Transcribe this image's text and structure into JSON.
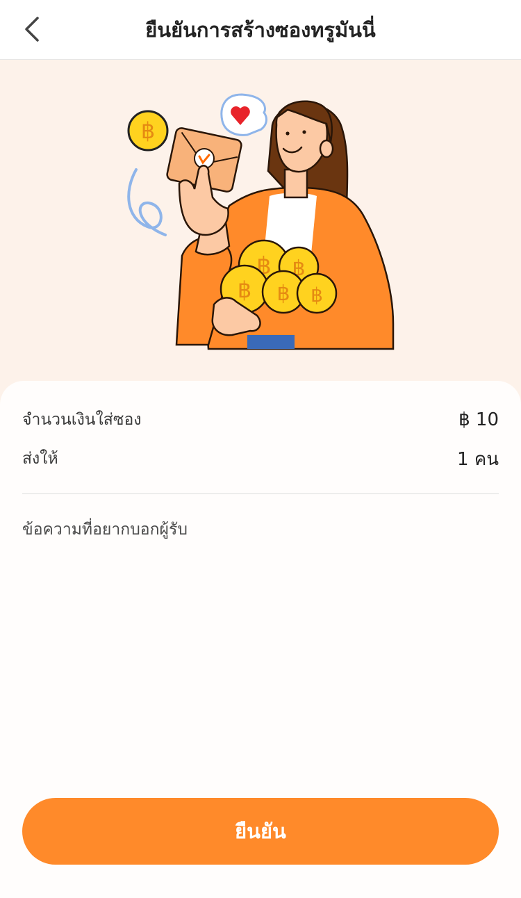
{
  "header": {
    "back_icon": "chevron-left-icon",
    "title": "ยืนยันการสร้างซองทรูมันนี่"
  },
  "hero": {
    "illustration": "woman-holding-envelope-and-coins",
    "coin_symbol": "฿"
  },
  "summary": {
    "amount_label": "จำนวนเงินใส่ซอง",
    "amount_value": "฿ 10",
    "recipients_label": "ส่งให้",
    "recipients_value": "1 คน"
  },
  "message": {
    "placeholder": "ข้อความที่อยากบอกผู้รับ"
  },
  "actions": {
    "confirm_label": "ยืนยัน"
  },
  "colors": {
    "accent": "#ff8a2a",
    "background": "#fdf2ea",
    "coin": "#ffd21f"
  }
}
